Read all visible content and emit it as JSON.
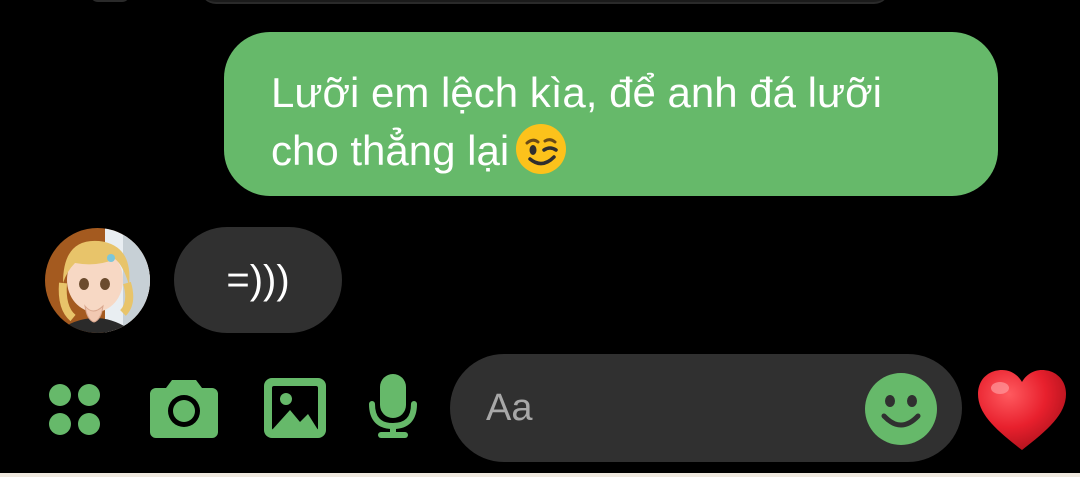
{
  "conversation": {
    "outgoing_message": {
      "line1": "Lưỡi em lệch kìa, để anh đá lưỡi",
      "line2": "cho thẳng lại"
    },
    "incoming_message": {
      "text": "=)))"
    }
  },
  "composer": {
    "placeholder": "Aa"
  },
  "icons": {
    "toolbar": [
      "apps-grid-icon",
      "camera-icon",
      "gallery-icon",
      "microphone-icon"
    ],
    "composer": [
      "emoji-smile-icon"
    ],
    "send": "heart-icon",
    "message_emoji": "wink-emoji-icon"
  },
  "colors": {
    "accent": "#66b96a",
    "outgoing_bubble": "#66b96a",
    "incoming_bubble": "#303030",
    "background": "#000000",
    "heart": "#e8202d"
  }
}
